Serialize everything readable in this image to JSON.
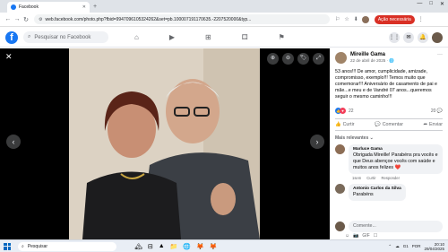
{
  "browser": {
    "tab_title": "Facebook",
    "tab_close": "✕",
    "new_tab": "+",
    "window_controls": [
      "—",
      "□",
      "✕"
    ],
    "url": "web.facebook.com/photo.php?fbid=9947096105324262&set=pb.100007191170635.-2207520000&typ...",
    "nav": [
      "←",
      "→",
      "↻"
    ],
    "action_button": "Ação necessária",
    "toolbar_icons": [
      "⚐",
      "☆",
      "⬇"
    ]
  },
  "facebook": {
    "logo": "f",
    "search_placeholder": "Pesquisar no Facebook",
    "nav_icons": [
      "⌂",
      "▶",
      "⊞",
      "⚃",
      "⚑"
    ],
    "right_icons": [
      "⋮⋮",
      "✉",
      "🔔"
    ]
  },
  "viewer": {
    "close": "✕",
    "prev": "‹",
    "next": "›",
    "tools": [
      "⊕",
      "⊖",
      "🏷",
      "⤢"
    ]
  },
  "post": {
    "author": "Mireille Gama",
    "date": "22 de abril de 2025 · 🌐",
    "more": "···",
    "text": "53 anos!!! De amor, cumplicidade, amizade, compromisso, exemplo!!! Temos muito que comemorar!!! Aniversário de casamento de pai e mãe...e meu e de Vandré 07 anos...queremos seguir o mesmo caminho!!!",
    "reaction_count": "22",
    "comment_count": "20 💬",
    "actions": {
      "like": "Curtir",
      "comment": "Comentar",
      "share": "Enviar"
    },
    "relevance": "Mais relevantes ⌄"
  },
  "comments": [
    {
      "name": "Marluce Gama",
      "text": "Obrigada Mireille! Parabéns pra vocês e que Deus abençoe vocês com saúde e muitos anos felizes ❤️",
      "time": "1sem",
      "like": "Curtir",
      "reply": "Responder",
      "color": "#8c6d55"
    },
    {
      "name": "Antonio Carlos da Silva",
      "text": "Parabéns",
      "color": "#7a6a5a"
    }
  ],
  "composer": {
    "placeholder": "Comente...",
    "tools": [
      "☺",
      "📷",
      "GIF",
      "☐"
    ]
  },
  "taskbar": {
    "search": "Pesquisar",
    "apps": [
      "🏔",
      "⊟",
      "▲",
      "📁",
      "🌐",
      "🦊",
      "🦊"
    ],
    "language": "POR",
    "time": "20:10",
    "date": "29/04/2025",
    "region": "G1",
    "tray_icons": [
      "⌃",
      "☁"
    ]
  }
}
